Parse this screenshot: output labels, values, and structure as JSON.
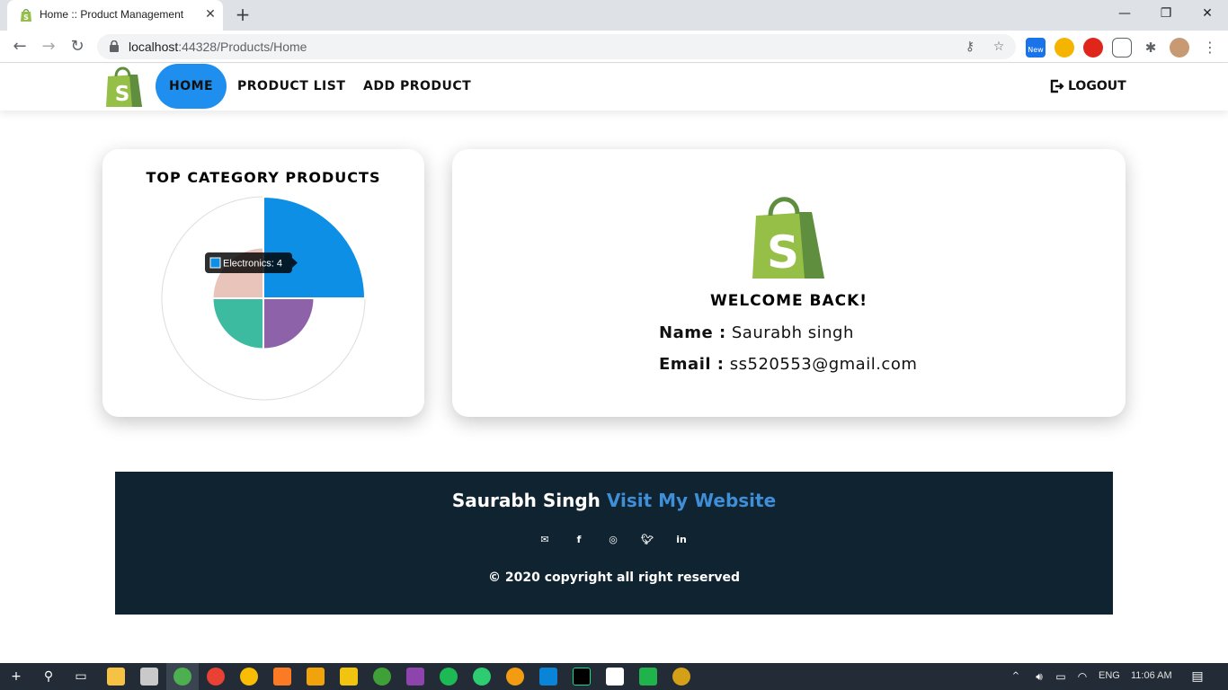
{
  "browser": {
    "tab_title": "Home :: Product Management",
    "tab_close": "✕",
    "new_tab": "+",
    "url_host": "localhost",
    "url_path": ":44328/Products/Home",
    "ext_new_label": "New",
    "window_controls": {
      "minimize": "—",
      "restore": "❐",
      "close": "✕"
    }
  },
  "nav": {
    "links": [
      "HOME",
      "PRODUCT LIST",
      "ADD PRODUCT"
    ],
    "active": "HOME",
    "logout": "LOGOUT"
  },
  "chart_card": {
    "title": "TOP CATEGORY PRODUCTS",
    "tooltip": "Electronics: 4"
  },
  "chart_data": {
    "type": "polarArea",
    "title": "TOP CATEGORY PRODUCTS",
    "series": [
      {
        "name": "Electronics",
        "value": 4,
        "color": "#0e8fe6"
      },
      {
        "value": 2,
        "color": "#8e62a8"
      },
      {
        "value": 2,
        "color": "#3cbba0"
      },
      {
        "value": 2,
        "color": "#e8c4bb"
      }
    ],
    "rmax": 4,
    "gridlines": [
      2,
      4
    ],
    "legend": "none",
    "tooltip": {
      "label": "Electronics: 4",
      "color": "#0e8fe6"
    }
  },
  "welcome": {
    "title": "WELCOME BACK!",
    "name_label": "Name :",
    "name_value": "Saurabh singh",
    "email_label": "Email :",
    "email_value": "ss520553@gmail.com"
  },
  "footer": {
    "author": "Saurabh Singh",
    "link": "Visit My Website",
    "copyright": "© 2020 copyright all right reserved",
    "social_icons": [
      "mail-icon",
      "facebook-icon",
      "instagram-icon",
      "twitter-icon",
      "linkedin-icon"
    ]
  },
  "taskbar": {
    "language": "ENG",
    "time": "11:06 AM"
  },
  "colors": {
    "nav_active": "#1e8fef",
    "footer_bg": "#102330",
    "footer_link": "#3f8ed8",
    "shopify_green": "#5e8e3e"
  }
}
